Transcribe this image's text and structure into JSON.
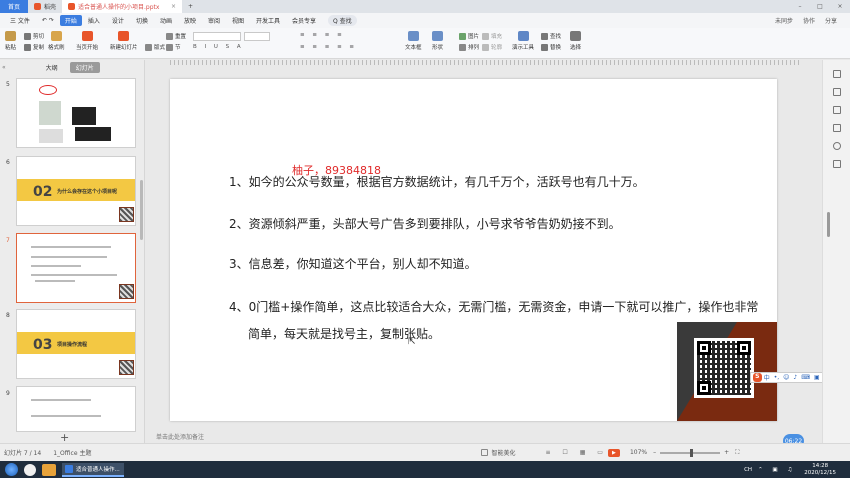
{
  "tabs": {
    "home": "首页",
    "tab1": "稻壳",
    "doc": "适合普通人操作的小项目.pptx",
    "new_tab": "+"
  },
  "menu": {
    "items": [
      "三 文件",
      "开始",
      "插入",
      "设计",
      "切换",
      "动画",
      "放映",
      "审阅",
      "视图",
      "开发工具",
      "会员专享"
    ],
    "active_label": "开始",
    "search": "Q 查找",
    "right": [
      "未同步",
      "协作",
      "分享"
    ]
  },
  "ribbon": {
    "paste": "粘贴",
    "cut": "剪切",
    "copy": "复制",
    "format_painter": "格式刷",
    "play_from_current": "当页开始",
    "new_slide": "新建幻灯片",
    "layout": "版式",
    "section": "节",
    "reset": "重置",
    "text_box": "文本框",
    "shape": "形状",
    "arrange": "排列",
    "picture": "图片",
    "fill": "填充",
    "outline": "轮廓",
    "presentation_tools": "演示工具",
    "find": "查找",
    "replace": "替换",
    "select": "选择"
  },
  "left_panel": {
    "tab_outline": "大纲",
    "tab_slides": "幻灯片",
    "slides": [
      {
        "num": "5"
      },
      {
        "num": "6",
        "big": "02",
        "title": "为什么会存在这个小项目呢"
      },
      {
        "num": "7"
      },
      {
        "num": "8",
        "big": "03",
        "title": "项目操作流程"
      },
      {
        "num": "9"
      }
    ],
    "add_slide": "+"
  },
  "slide": {
    "lines": [
      "1、如今的公众号数量，根据官方数据统计，有几千万个，活跃号也有几十万。",
      "2、资源倾斜严重，头部大号广告多到要排队，小号求爷爷告奶奶接不到。",
      "3、信息差，你知道这个平台，别人却不知道。",
      "4、0门槛+操作简单，这点比较适合大众，无需门槛，无需资金，申请一下就可以推广，操作也非常",
      "简单，每天就是找号主，复制张贴。"
    ],
    "watermark": "柚子，89384818"
  },
  "ime": {
    "logo": "S",
    "mode": "中"
  },
  "notes_placeholder": "单击此处添加备注",
  "status": {
    "slide_info": "幻灯片 7 / 14",
    "theme": "1_Office 主题",
    "smart_beautify": "智能美化",
    "zoom": "107%",
    "time_bubble": "06:22"
  },
  "taskbar": {
    "task_label": "适合普通人操作...",
    "time": "14:28",
    "date": "2020/12/15",
    "ime_tray": "CH"
  },
  "colors": {
    "accent": "#3b7de0",
    "slide_yellow": "#f3c843",
    "qr_block": "#7a2a10",
    "watermark": "#e02b2b"
  }
}
